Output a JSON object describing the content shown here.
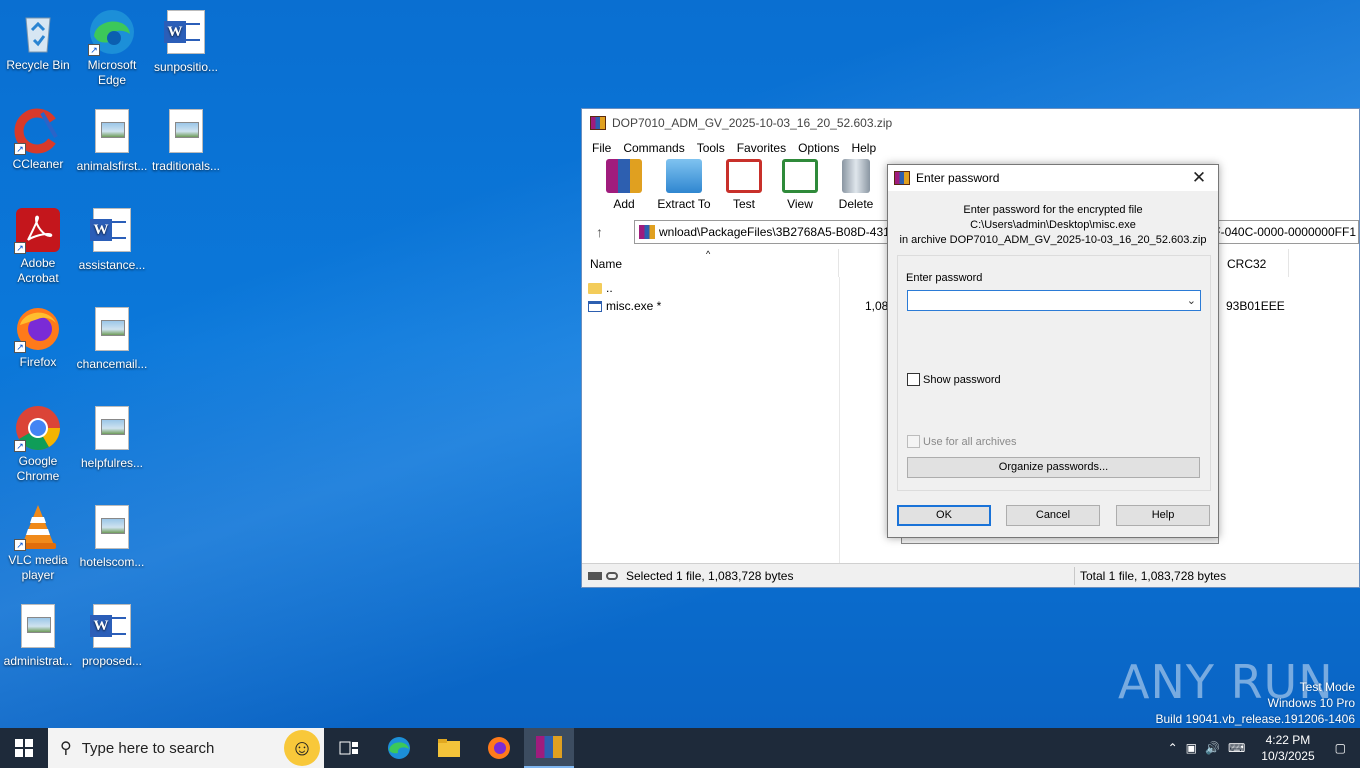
{
  "desktop": {
    "icons": [
      {
        "label": "Recycle Bin",
        "icon": "recycle-bin-icon"
      },
      {
        "label": "Microsoft Edge",
        "icon": "edge-icon"
      },
      {
        "label": "sunpositio...",
        "icon": "word-doc-icon"
      },
      {
        "label": "CCleaner",
        "icon": "ccleaner-icon"
      },
      {
        "label": "animalsfirst...",
        "icon": "image-file-icon"
      },
      {
        "label": "traditionals...",
        "icon": "image-file-icon"
      },
      {
        "label": "Adobe Acrobat",
        "icon": "acrobat-icon"
      },
      {
        "label": "assistance...",
        "icon": "word-doc-icon"
      },
      {
        "label": "Firefox",
        "icon": "firefox-icon"
      },
      {
        "label": "chancemail...",
        "icon": "image-file-icon"
      },
      {
        "label": "Google Chrome",
        "icon": "chrome-icon"
      },
      {
        "label": "helpfulres...",
        "icon": "image-file-icon"
      },
      {
        "label": "VLC media player",
        "icon": "vlc-icon"
      },
      {
        "label": "hotelscom...",
        "icon": "image-file-icon"
      },
      {
        "label": "administrat...",
        "icon": "image-file-icon"
      },
      {
        "label": "proposed...",
        "icon": "word-doc-icon"
      }
    ]
  },
  "winrar": {
    "title": "DOP7010_ADM_GV_2025-10-03_16_20_52.603.zip",
    "menu": [
      "File",
      "Commands",
      "Tools",
      "Favorites",
      "Options",
      "Help"
    ],
    "toolbar": [
      "Add",
      "Extract To",
      "Test",
      "View",
      "Delete"
    ],
    "address": "wnload\\PackageFiles\\3B2768A5-B08D-431A",
    "address_right": "01F-040C-0000-0000000FF1",
    "columns": {
      "name": "Name",
      "crc": "CRC32"
    },
    "rows": [
      {
        "name": "..",
        "size": "",
        "crc": ""
      },
      {
        "name": "misc.exe *",
        "size": "1,08",
        "crc": "93B01EEE"
      }
    ],
    "status_left": "Selected 1 file, 1,083,728 bytes",
    "status_right": "Total 1 file, 1,083,728 bytes"
  },
  "dialog": {
    "title": "Enter password",
    "msg_line1": "Enter password for the encrypted file",
    "msg_line2": "C:\\Users\\admin\\Desktop\\misc.exe",
    "msg_line3": "in archive DOP7010_ADM_GV_2025-10-03_16_20_52.603.zip",
    "field_label": "Enter password",
    "password_value": "",
    "show_password": "Show password",
    "use_for_all": "Use for all archives",
    "organize": "Organize passwords...",
    "ok": "OK",
    "cancel": "Cancel",
    "help": "Help"
  },
  "taskbar": {
    "search_placeholder": "Type here to search",
    "time": "4:22 PM",
    "date": "10/3/2025"
  },
  "watermark": {
    "line1": "Test Mode",
    "line2": "Windows 10 Pro",
    "line3": "Build 19041.vb_release.191206-1406",
    "brand": "ANY RUN"
  }
}
